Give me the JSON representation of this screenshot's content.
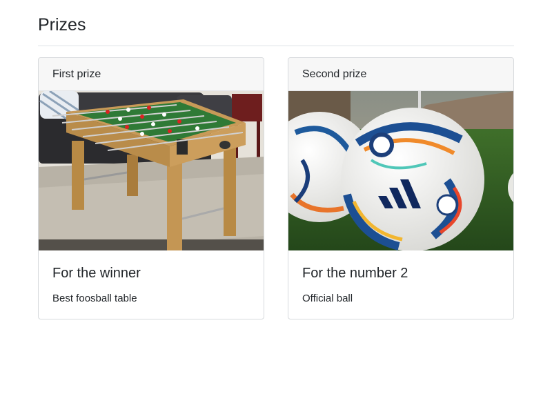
{
  "page": {
    "title": "Prizes"
  },
  "cards": [
    {
      "header": "First prize",
      "image": "foosball-table-photo",
      "title": "For the winner",
      "text": "Best foosball table"
    },
    {
      "header": "Second prize",
      "image": "soccer-balls-photo",
      "title": "For the number 2",
      "text": "Official ball"
    }
  ]
}
